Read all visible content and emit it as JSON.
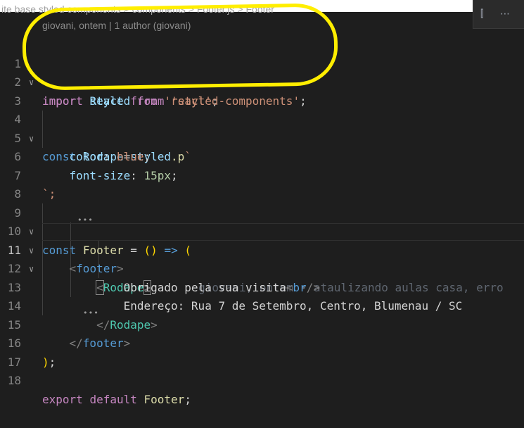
{
  "breadcrumb": "ite base styled components > components > Footer.js > Footer",
  "codelens": "giovani, ontem | 1 author (giovani)",
  "lines": [
    "1",
    "2",
    "3",
    "4",
    "5",
    "6",
    "7",
    "8",
    "9",
    "10",
    "11",
    "12",
    "13",
    "14",
    "15",
    "16",
    "17",
    "18"
  ],
  "code": {
    "l1": {
      "import": "import",
      "name": "React",
      "from": "from",
      "module": "'react'",
      "end": ";"
    },
    "l2": {
      "import": "import",
      "name": "styled",
      "from": "from",
      "module": "'styled-components'",
      "end": ";"
    },
    "l4": {
      "const": "const",
      "name": "Rodape",
      "eq": "=",
      "obj": "styled",
      "prop": ".p",
      "tick": "`"
    },
    "l5": {
      "prop": "color",
      "colon": ":",
      "value": "blue",
      "end": ";"
    },
    "l6": {
      "prop": "font-size",
      "colon": ":",
      "value": "15px",
      "end": ";"
    },
    "l7": {
      "end": "`;"
    },
    "l9": {
      "const": "const",
      "name": "Footer",
      "eq": "=",
      "args": "()",
      "arrow": "=>",
      "open": "("
    },
    "l10": {
      "lt": "<",
      "tag": "footer",
      "gt": ">"
    },
    "l11": {
      "lt": "<",
      "tag": "Rodape",
      "gt": ">",
      "blame": "giovani, ontem • ataulizando aulas casa, erro"
    },
    "l12": {
      "text": "Obrigado pela sua visita",
      "lt": "<",
      "tag": "br",
      "close": "/>"
    },
    "l13": {
      "text": "Endereço: Rua 7 de Setembro, Centro, Blumenau / SC"
    },
    "l14": {
      "lt": "</",
      "tag": "Rodape",
      "gt": ">"
    },
    "l15": {
      "lt": "</",
      "tag": "footer",
      "gt": ">"
    },
    "l16": {
      "close": ")",
      "end": ";"
    },
    "l18": {
      "export": "export",
      "default": "default",
      "name": "Footer",
      "end": ";"
    }
  },
  "icons": {
    "fold": "chevron-down-icon",
    "toolbar_a": "split-editor-icon",
    "toolbar_b": "more-icon"
  },
  "colors": {
    "background": "#1e1e1e",
    "annotation": "#ffee00"
  }
}
